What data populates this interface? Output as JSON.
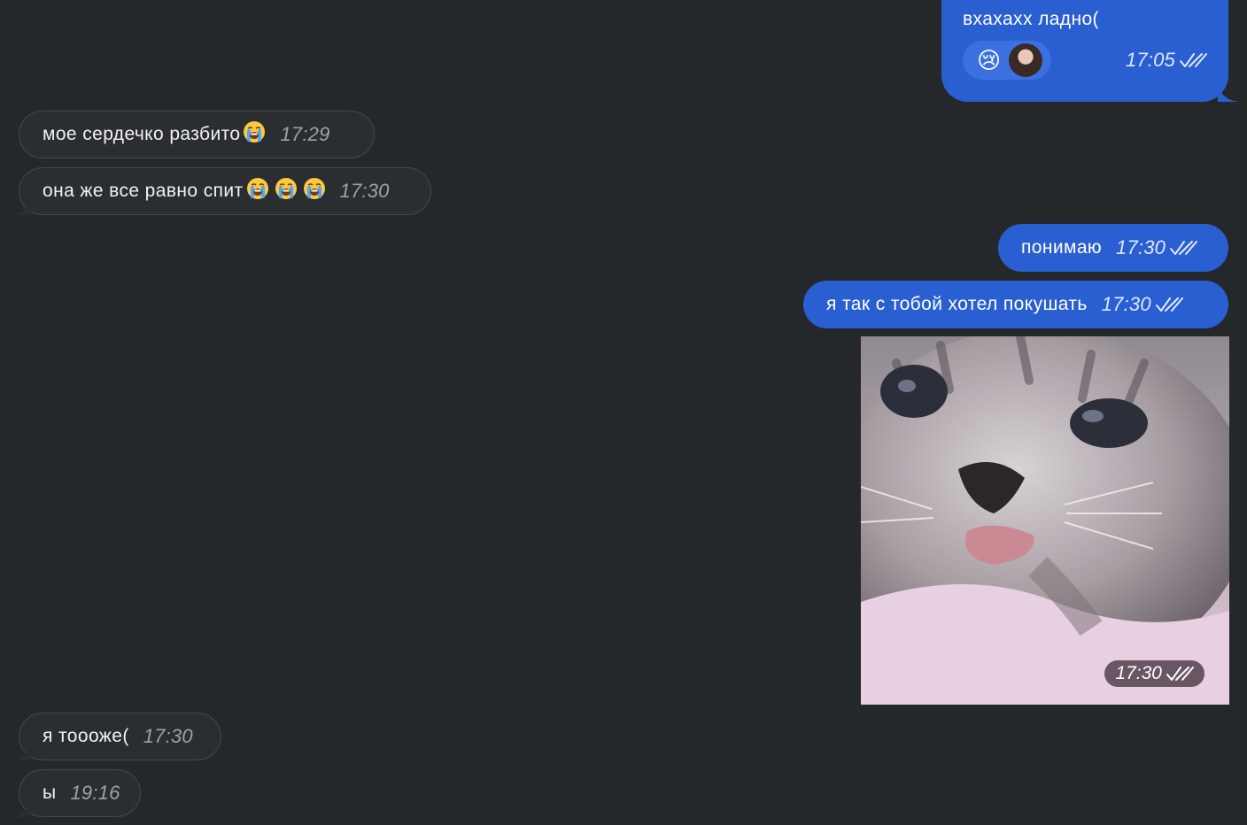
{
  "messages": {
    "m1": {
      "text": "вхахахх ладно(",
      "time": "17:05",
      "reaction_emoji": "😢"
    },
    "m2": {
      "text": "мое сердечко разбито",
      "emoji": "😭",
      "time": "17:29"
    },
    "m3": {
      "text": "она же все равно спит",
      "emoji": "😭😭😭",
      "time": "17:30"
    },
    "m4": {
      "text": "понимаю",
      "time": "17:30"
    },
    "m5": {
      "text": "я так с тобой хотел покушать",
      "time": "17:30"
    },
    "m6": {
      "time": "17:30"
    },
    "m7": {
      "text": "я тоооже(",
      "time": "17:30"
    },
    "m8": {
      "text": "ы",
      "time": "19:16"
    }
  },
  "colors": {
    "background": "#25282b",
    "incoming_bubble": "#2b2e31",
    "outgoing_bubble": "#2a5fd1"
  },
  "icons": {
    "read_status": "double-check-icon",
    "reaction": "crying-face-emoji",
    "loudly_crying": "loudly-crying-face-emoji"
  }
}
